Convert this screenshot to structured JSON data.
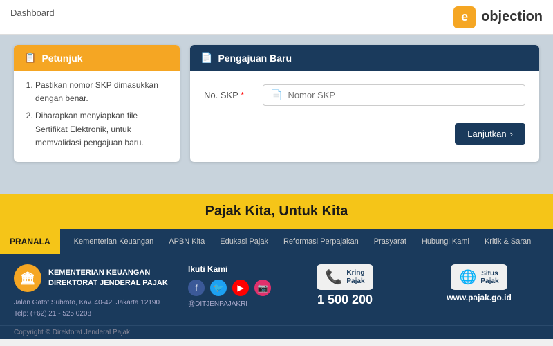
{
  "header": {
    "logo_letter": "e",
    "logo_text": "objection"
  },
  "breadcrumb": {
    "label": "Dashboard"
  },
  "petunjuk": {
    "title": "Petunjuk",
    "items": [
      "Pastikan nomor SKP dimasukkan dengan benar.",
      "Diharapkan menyiapkan file Sertifikat Elektronik, untuk memvalidasi pengajuan baru."
    ]
  },
  "pengajuan": {
    "title": "Pengajuan Baru",
    "form": {
      "skp_label": "No. SKP",
      "skp_placeholder": "Nomor SKP",
      "required_mark": "*",
      "submit_label": "Lanjutkan",
      "submit_arrow": "›"
    }
  },
  "banner": {
    "text": "Pajak Kita, Untuk Kita"
  },
  "nav": {
    "pranala": "PRANALA",
    "links": [
      "Kementerian Keuangan",
      "APBN Kita",
      "Edukasi Pajak",
      "Reformasi Perpajakan",
      "Prasyarat",
      "Hubungi Kami",
      "Kritik & Saran"
    ]
  },
  "footer": {
    "org_name_line1": "KEMENTERIAN KEUANGAN",
    "org_name_line2": "DIREKTORAT JENDERAL PAJAK",
    "address": "Jalan Gatot Subroto, Kav. 40-42, Jakarta 12190",
    "phone_address": "Telp: (+62) 21 - 525 0208",
    "social_title": "Ikuti Kami",
    "social_handle": "@DITJENPAJAKRI",
    "kring_line1": "Kring",
    "kring_line2": "Pajak",
    "phone_number": "1 500 200",
    "situs_label": "Situs\nPajak",
    "website_url": "www.pajak.go.id",
    "copyright": "Copyright © Direktorat Jenderal Pajak."
  }
}
